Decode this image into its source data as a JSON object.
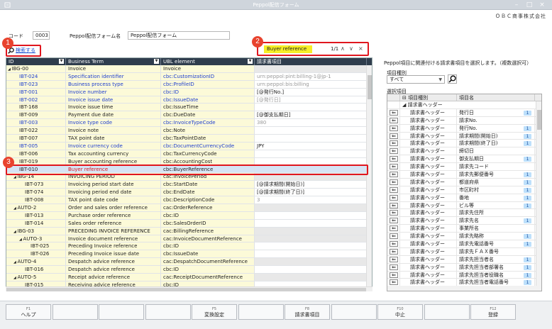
{
  "window": {
    "title": "Peppol配信フォーム",
    "company": "ＯＢＣ商事株式会社"
  },
  "header": {
    "code_label": "コード",
    "code_value": "0003",
    "form_name_label": "Peppol配信フォーム名",
    "form_name_value": "Peppol配信フォーム"
  },
  "search": {
    "link_label": "検索する",
    "find_value": "Buyer reference",
    "find_count": "1/1"
  },
  "annotations": [
    "1",
    "2",
    "3"
  ],
  "grid": {
    "columns": [
      "ID",
      "Business Term",
      "UBL element",
      "請求書項目"
    ],
    "rows": [
      {
        "id": "IBG-00",
        "term": "Invoice",
        "ubl": "Invoice",
        "item": "",
        "indent": 0,
        "group": true
      },
      {
        "id": "IBT-024",
        "term": "Specification identifier",
        "ubl": "cbc:CustomizationID",
        "item": "urn:peppol:pint:billing-1@jp-1",
        "indent": 1,
        "blue": true,
        "itemgray": true
      },
      {
        "id": "IBT-023",
        "term": "Business process type",
        "ubl": "cbc:ProfileID",
        "item": "urn:peppol:bis:billing",
        "indent": 1,
        "blue": true,
        "itemgray": true
      },
      {
        "id": "IBT-001",
        "term": "Invoice number",
        "ubl": "cbc:ID",
        "item": "[@発行No.]",
        "indent": 1,
        "blue": true
      },
      {
        "id": "IBT-002",
        "term": "Invoice issue date",
        "ubl": "cbc:IssueDate",
        "item": "[@発行日]",
        "indent": 1,
        "blue": true,
        "itemgray": true
      },
      {
        "id": "IBT-168",
        "term": "Invoice issue time",
        "ubl": "cbc:IssueTime",
        "item": "",
        "indent": 1
      },
      {
        "id": "IBT-009",
        "term": "Payment due date",
        "ubl": "cbc:DueDate",
        "item": "[@御支払期日]",
        "indent": 1
      },
      {
        "id": "IBT-003",
        "term": "Invoice type code",
        "ubl": "cbc:InvoiceTypeCode",
        "item": "380",
        "indent": 1,
        "blue": true,
        "itemgray": true
      },
      {
        "id": "IBT-022",
        "term": "Invoice note",
        "ubl": "cbc:Note",
        "item": "",
        "indent": 1
      },
      {
        "id": "IBT-007",
        "term": "TAX point date",
        "ubl": "cbc:TaxPointDate",
        "item": "",
        "indent": 1
      },
      {
        "id": "IBT-005",
        "term": "Invoice currency code",
        "ubl": "cbc:DocumentCurrencyCode",
        "item": "JPY",
        "indent": 1,
        "blue": true
      },
      {
        "id": "IBT-006",
        "term": "Tax accounting currency",
        "ubl": "cbc:TaxCurrencyCode",
        "item": "",
        "indent": 1
      },
      {
        "id": "IBT-019",
        "term": "Buyer accounting reference",
        "ubl": "cbc:AccountingCost",
        "item": "",
        "indent": 1
      },
      {
        "id": "IBT-010",
        "term": "Buyer reference",
        "ubl": "cbc:BuyerReference",
        "item": "",
        "indent": 1,
        "selected": true
      },
      {
        "id": "IBG-14",
        "term": "INVOICING PERIOD",
        "ubl": "cac:InvoicePeriod",
        "item": "",
        "indent": 1,
        "group": true
      },
      {
        "id": "IBT-073",
        "term": "Invoicing period start date",
        "ubl": "cbc:StartDate",
        "item": "[@請求期間(開始日)]",
        "indent": 2
      },
      {
        "id": "IBT-074",
        "term": "Invoicing period end date",
        "ubl": "cbc:EndDate",
        "item": "[@請求期間(終了日)]",
        "indent": 2
      },
      {
        "id": "IBT-008",
        "term": "TAX point date code",
        "ubl": "cbc:DescriptionCode",
        "item": "3",
        "indent": 2,
        "itemgray": true
      },
      {
        "id": "AUTO-2",
        "term": "Order and sales order reference",
        "ubl": "cac:OrderReference",
        "item": "",
        "indent": 1,
        "group": true
      },
      {
        "id": "IBT-013",
        "term": "Purchase order reference",
        "ubl": "cbc:ID",
        "item": "",
        "indent": 2
      },
      {
        "id": "IBT-014",
        "term": "Sales order reference",
        "ubl": "cbc:SalesOrderID",
        "item": "",
        "indent": 2
      },
      {
        "id": "IBG-03",
        "term": "PRECEDING INVOICE REFERENCE",
        "ubl": "cac:BillingReference",
        "item": "",
        "indent": 1,
        "group": true
      },
      {
        "id": "AUTO-3",
        "term": "Invoice document reference",
        "ubl": "cac:InvoiceDocumentReference",
        "item": "",
        "indent": 2,
        "group": true
      },
      {
        "id": "IBT-025",
        "term": "Preceding Invoice reference",
        "ubl": "cbc:ID",
        "item": "",
        "indent": 3
      },
      {
        "id": "IBT-026",
        "term": "Preceding Invoice issue date",
        "ubl": "cbc:IssueDate",
        "item": "",
        "indent": 3
      },
      {
        "id": "AUTO-4",
        "term": "Despatch advice reference",
        "ubl": "cac:DespatchDocumentReference",
        "item": "",
        "indent": 1,
        "group": true
      },
      {
        "id": "IBT-016",
        "term": "Despatch advice reference",
        "ubl": "cbc:ID",
        "item": "",
        "indent": 2
      },
      {
        "id": "AUTO-5",
        "term": "Receipt advice reference",
        "ubl": "cac:ReceiptDocumentReference",
        "item": "",
        "indent": 1,
        "group": true
      },
      {
        "id": "IBT-015",
        "term": "Receiving advice reference",
        "ubl": "cbc:ID",
        "item": "",
        "indent": 2
      }
    ]
  },
  "right_panel": {
    "title": "Peppol項目に関連付ける請求書項目を選択します。（複数選択可）",
    "type_label": "項目種別",
    "type_value": "すべて",
    "list_label": "選択項目",
    "columns": [
      "項目種別",
      "項目名"
    ],
    "root": "請求書ヘッダー",
    "items": [
      {
        "type": "請求書ヘッダー",
        "name": "発行日",
        "count": "1"
      },
      {
        "type": "請求書ヘッダー",
        "name": "請求No.",
        "count": ""
      },
      {
        "type": "請求書ヘッダー",
        "name": "発行No.",
        "count": "1"
      },
      {
        "type": "請求書ヘッダー",
        "name": "請求期間(開始日)",
        "count": "1"
      },
      {
        "type": "請求書ヘッダー",
        "name": "請求期間(終了日)",
        "count": "1"
      },
      {
        "type": "請求書ヘッダー",
        "name": "締切日",
        "count": ""
      },
      {
        "type": "請求書ヘッダー",
        "name": "御支払期日",
        "count": "1"
      },
      {
        "type": "請求書ヘッダー",
        "name": "請求先コード",
        "count": ""
      },
      {
        "type": "請求書ヘッダー",
        "name": "請求先郵便番号",
        "count": "1"
      },
      {
        "type": "請求書ヘッダー",
        "name": "都道府県",
        "count": "1"
      },
      {
        "type": "請求書ヘッダー",
        "name": "市区町村",
        "count": "1"
      },
      {
        "type": "請求書ヘッダー",
        "name": "番地",
        "count": "1"
      },
      {
        "type": "請求書ヘッダー",
        "name": "ビル等",
        "count": "1"
      },
      {
        "type": "請求書ヘッダー",
        "name": "請求先住所",
        "count": ""
      },
      {
        "type": "請求書ヘッダー",
        "name": "請求先名",
        "count": "1"
      },
      {
        "type": "請求書ヘッダー",
        "name": "事業所名",
        "count": ""
      },
      {
        "type": "請求書ヘッダー",
        "name": "請求先略称",
        "count": "1"
      },
      {
        "type": "請求書ヘッダー",
        "name": "請求先電話番号",
        "count": "1"
      },
      {
        "type": "請求書ヘッダー",
        "name": "請求先ＦＡＸ番号",
        "count": ""
      },
      {
        "type": "請求書ヘッダー",
        "name": "請求先担当者名",
        "count": "1"
      },
      {
        "type": "請求書ヘッダー",
        "name": "請求先担当者部署名",
        "count": "1"
      },
      {
        "type": "請求書ヘッダー",
        "name": "請求先担当者役職名",
        "count": "1"
      },
      {
        "type": "請求書ヘッダー",
        "name": "請求先担当者電話番号",
        "count": "1"
      }
    ]
  },
  "footer": {
    "keys": [
      {
        "fn": "F1",
        "label": "ヘルプ"
      },
      {
        "fn": "",
        "label": ""
      },
      {
        "fn": "",
        "label": ""
      },
      {
        "fn": "",
        "label": ""
      },
      {
        "fn": "F5",
        "label": "変換設定"
      },
      {
        "fn": "",
        "label": ""
      },
      {
        "fn": "F8",
        "label": "請求書項目"
      },
      {
        "fn": "",
        "label": ""
      },
      {
        "fn": "F10",
        "label": "中止"
      },
      {
        "fn": "",
        "label": ""
      },
      {
        "fn": "F12",
        "label": "登録"
      }
    ]
  }
}
